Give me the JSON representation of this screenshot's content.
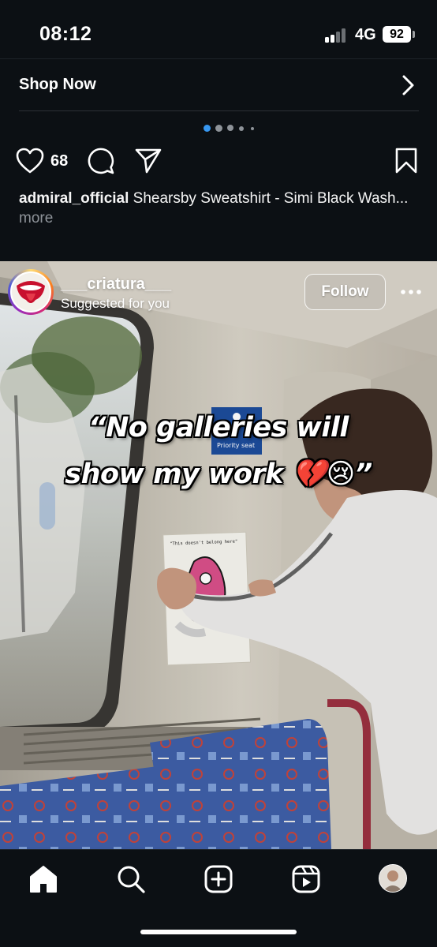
{
  "status_bar": {
    "time": "08:12",
    "network": "4G",
    "battery": "92"
  },
  "ad": {
    "cta_label": "Shop Now",
    "carousel_pages": 5,
    "carousel_active": 1
  },
  "post": {
    "likes": "68",
    "caption_user": "admiral_official",
    "caption_text": " Shearsby Sweatshirt - Simi Black Wash...",
    "caption_more": " more"
  },
  "reel": {
    "username": "___criatura___",
    "subtitle": "Suggested for you",
    "follow_label": "Follow",
    "overlay_line1": "“No galleries will",
    "overlay_line2": "show my work 💔😢”",
    "poster_caption": "\"This doesn't belong here\"",
    "sign_text": "Priority seat"
  },
  "nav": {
    "items": [
      "home-icon",
      "search-icon",
      "create-icon",
      "reels-icon",
      "profile-avatar"
    ]
  },
  "colors": {
    "background": "#0c1014",
    "accent_dot": "#3797f0",
    "text": "#f5f5f5",
    "muted": "#8e9399"
  }
}
